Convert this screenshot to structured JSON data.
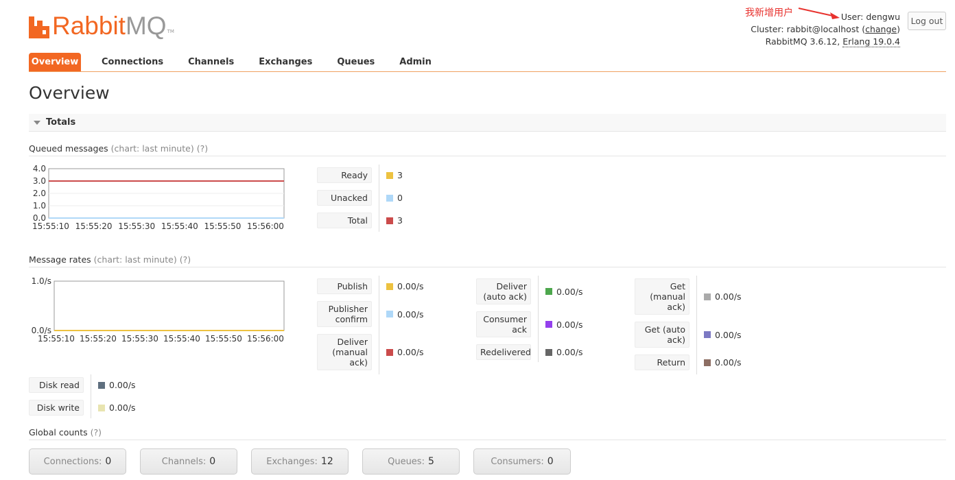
{
  "header": {
    "logo_rabbit": "Rabbit",
    "logo_mq": "MQ",
    "logo_tm": "TM",
    "annotation": "我新增用户",
    "user_label": "User:",
    "user_name": "dengwu",
    "cluster_label": "Cluster:",
    "cluster_name": "rabbit@localhost",
    "cluster_change": "change",
    "version": "RabbitMQ 3.6.12,",
    "erlang": "Erlang 19.0.4",
    "logout": "Log out"
  },
  "nav": {
    "tabs": [
      "Overview",
      "Connections",
      "Channels",
      "Exchanges",
      "Queues",
      "Admin"
    ],
    "active": "Overview"
  },
  "page_title": "Overview",
  "totals_label": "Totals",
  "queued": {
    "title": "Queued messages",
    "chart_note": "(chart: last minute)",
    "help": "(?)",
    "legend": [
      {
        "label": "Ready",
        "value": "3",
        "color": "#edc240"
      },
      {
        "label": "Unacked",
        "value": "0",
        "color": "#afd8f8"
      },
      {
        "label": "Total",
        "value": "3",
        "color": "#cb4b4b"
      }
    ]
  },
  "rates": {
    "title": "Message rates",
    "chart_note": "(chart: last minute)",
    "help": "(?)",
    "col1": [
      {
        "label": "Publish",
        "value": "0.00/s",
        "color": "#edc240"
      },
      {
        "label": "Publisher confirm",
        "value": "0.00/s",
        "color": "#afd8f8"
      },
      {
        "label": "Deliver (manual ack)",
        "value": "0.00/s",
        "color": "#cb4b4b"
      }
    ],
    "col2": [
      {
        "label": "Deliver (auto ack)",
        "value": "0.00/s",
        "color": "#4da74d"
      },
      {
        "label": "Consumer ack",
        "value": "0.00/s",
        "color": "#9440ed"
      },
      {
        "label": "Redelivered",
        "value": "0.00/s",
        "color": "#666666"
      }
    ],
    "col3": [
      {
        "label": "Get (manual ack)",
        "value": "0.00/s",
        "color": "#aaaaaa"
      },
      {
        "label": "Get (auto ack)",
        "value": "0.00/s",
        "color": "#7c79c3"
      },
      {
        "label": "Return",
        "value": "0.00/s",
        "color": "#8d6e63"
      }
    ],
    "disk": [
      {
        "label": "Disk read",
        "value": "0.00/s",
        "color": "#5f6f7f"
      },
      {
        "label": "Disk write",
        "value": "0.00/s",
        "color": "#e8e4b0"
      }
    ]
  },
  "global": {
    "title": "Global counts",
    "help": "(?)",
    "counts": [
      {
        "label": "Connections:",
        "value": "0"
      },
      {
        "label": "Channels:",
        "value": "0"
      },
      {
        "label": "Exchanges:",
        "value": "12"
      },
      {
        "label": "Queues:",
        "value": "5"
      },
      {
        "label": "Consumers:",
        "value": "0"
      }
    ]
  },
  "chart_data": [
    {
      "type": "line",
      "x": [
        "15:55:10",
        "15:55:20",
        "15:55:30",
        "15:55:40",
        "15:55:50",
        "15:56:00"
      ],
      "yticks": [
        "4.0",
        "3.0",
        "2.0",
        "1.0",
        "0.0"
      ],
      "ylim": [
        0,
        4
      ],
      "series": [
        {
          "name": "Ready",
          "color": "#edc240",
          "values": [
            3,
            3,
            3,
            3,
            3,
            3
          ]
        },
        {
          "name": "Unacked",
          "color": "#afd8f8",
          "values": [
            0,
            0,
            0,
            0,
            0,
            0
          ]
        },
        {
          "name": "Total",
          "color": "#cb4b4b",
          "values": [
            3,
            3,
            3,
            3,
            3,
            3
          ]
        }
      ]
    },
    {
      "type": "line",
      "x": [
        "15:55:10",
        "15:55:20",
        "15:55:30",
        "15:55:40",
        "15:55:50",
        "15:56:00"
      ],
      "yticks": [
        "1.0/s",
        "0.0/s"
      ],
      "ylim": [
        0,
        1
      ],
      "series": [
        {
          "name": "Publish",
          "color": "#edc240",
          "values": [
            0,
            0,
            0,
            0,
            0,
            0
          ]
        }
      ]
    }
  ]
}
